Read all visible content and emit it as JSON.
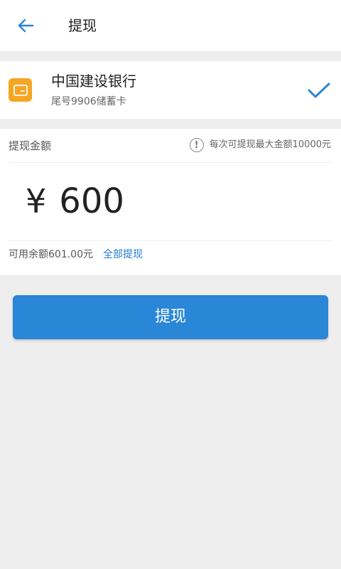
{
  "header": {
    "title": "提现",
    "back_icon": "arrow-left-icon"
  },
  "bank": {
    "name": "中国建设银行",
    "sub": "尾号9906储蓄卡",
    "icon": "bank-card-icon",
    "selected_icon": "check-icon",
    "icon_color": "#f5a623"
  },
  "withdraw": {
    "amount_label": "提现金额",
    "limit_text": "每次可提现最大金额10000元",
    "limit_icon": "info-icon",
    "currency_symbol": "¥",
    "amount_value": "600",
    "balance_text": "可用余额601.00元",
    "withdraw_all_label": "全部提现"
  },
  "submit": {
    "label": "提现"
  },
  "colors": {
    "accent": "#2a86d6",
    "link": "#1f7bd1",
    "background": "#eeeeee"
  }
}
